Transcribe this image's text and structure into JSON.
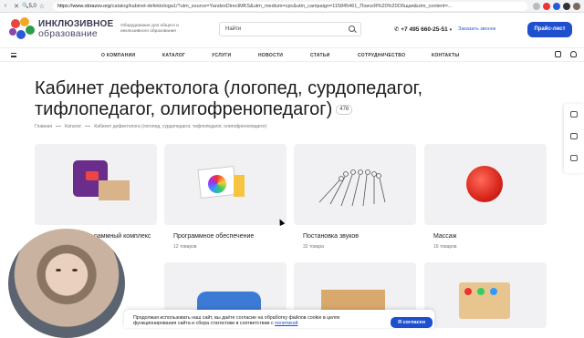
{
  "browser": {
    "zoom": "5,0",
    "url_host": "https://www.obrazov.org",
    "url_path": "/catalog/kabinet-defektologa1/?utm_source=YandexDirectMKS&utm_medium=cpc&utm_campaign=115845461_ПоискЯ%20%20Общая&utm_content=..."
  },
  "header": {
    "logo_line1": "ИНКЛЮЗИВНОЕ",
    "logo_line2": "образование",
    "tagline": "Оборудование для общего и инклюзивного образования",
    "search_placeholder": "Найти",
    "phone": "+7 495 660-25-51",
    "callback_label": "Заказать звонок",
    "price_button": "Прайс-лист"
  },
  "nav": {
    "items": [
      "О КОМПАНИИ",
      "КАТАЛОГ",
      "УСЛУГИ",
      "НОВОСТИ",
      "СТАТЬИ",
      "СОТРУДНИЧЕСТВО",
      "КОНТАКТЫ"
    ]
  },
  "page": {
    "title": "Кабинет дефектолога (логопед, сурдопедагог, тифлопедагог, олигофренопедагог)",
    "count": "476",
    "breadcrumb": [
      "Главная",
      "Каталог",
      "Кабинет дефектолога (логопед, сурдопедагог, тифлопедагог, олигофренопедагог)"
    ]
  },
  "cards": [
    {
      "title": "…раммный комплекс",
      "count": ""
    },
    {
      "title": "Программное обеспечение",
      "count": "12 товаров"
    },
    {
      "title": "Постановка звуков",
      "count": "32 товара"
    },
    {
      "title": "Массаж",
      "count": "16 товаров"
    }
  ],
  "cookie": {
    "text": "Продолжая использовать наш сайт, вы даёте согласие на обработку файлов cookie в целях функционирования сайта и сбора статистики в соответствии с",
    "link": "политикой",
    "button": "Я согласен"
  },
  "colors": {
    "accent": "#1e4fcf",
    "card_bg": "#f1f1f3"
  }
}
